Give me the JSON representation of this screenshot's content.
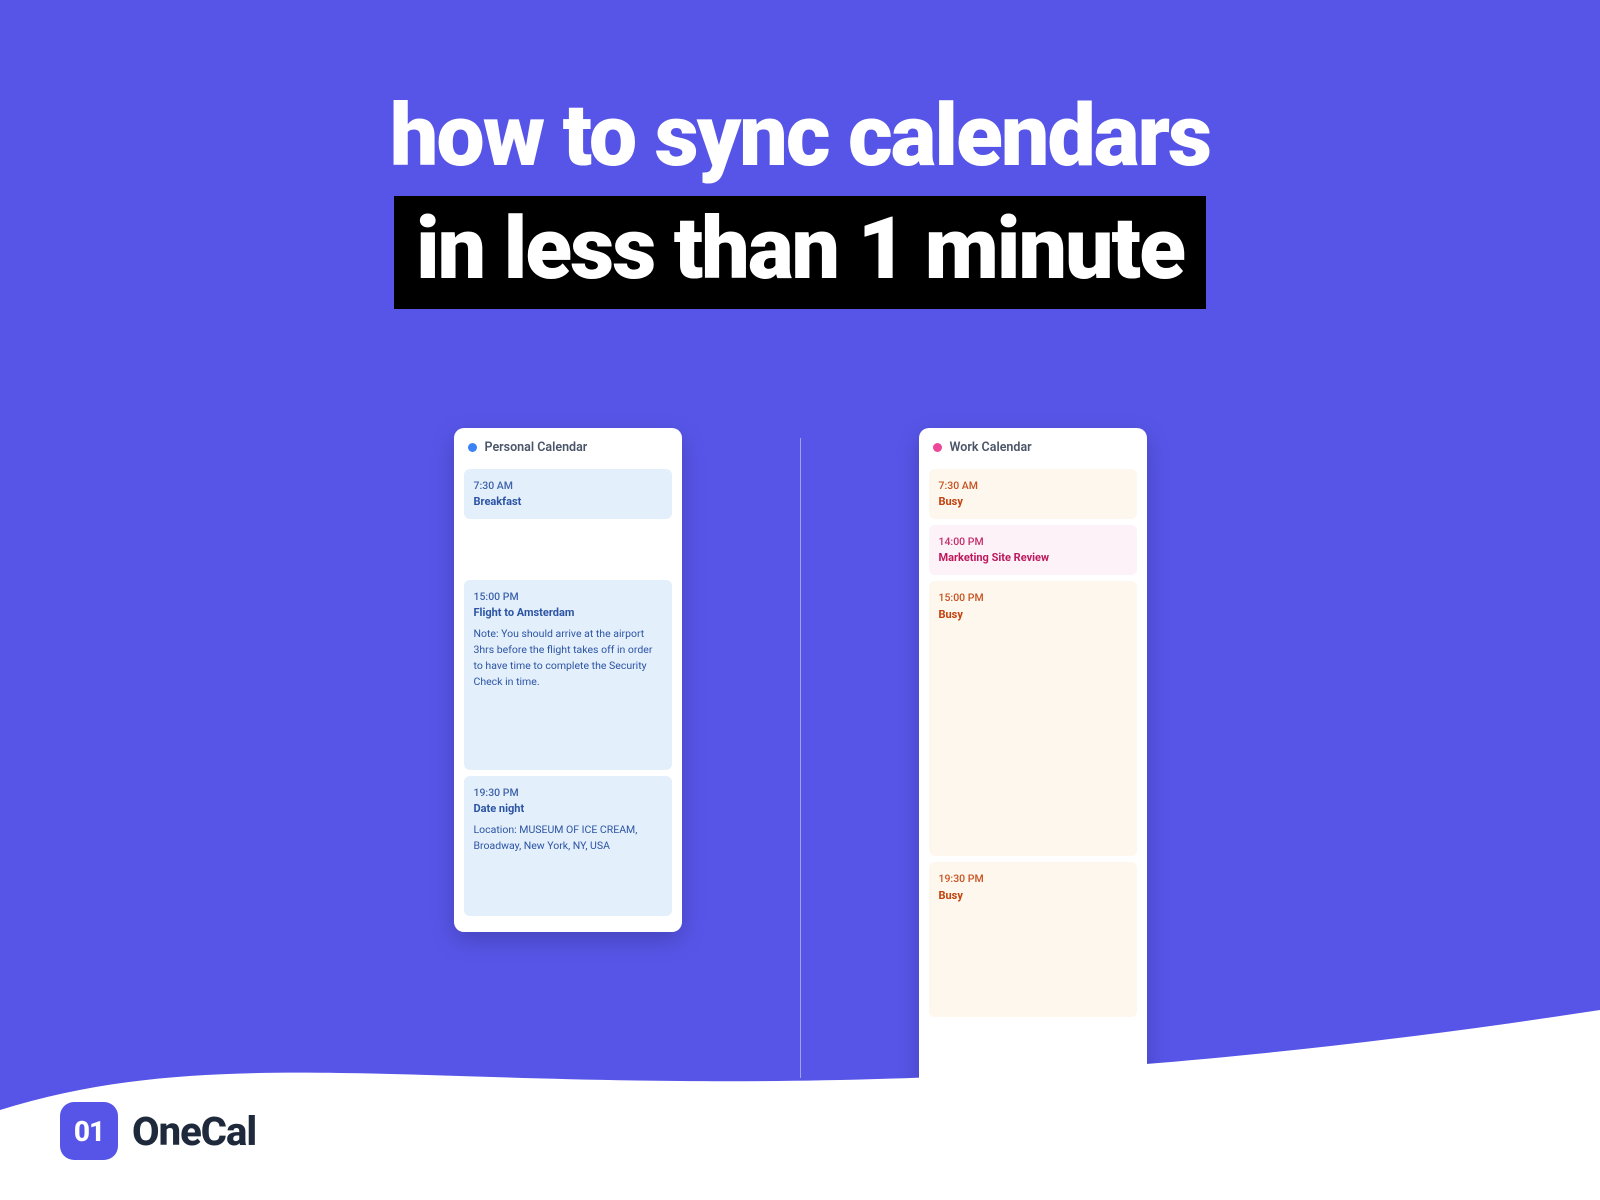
{
  "headline": {
    "line1": "how to sync calendars",
    "line2": "in less than 1 minute"
  },
  "calendars": {
    "personal": {
      "title": "Personal Calendar",
      "events": [
        {
          "time": "7:30 AM",
          "title": "Breakfast"
        },
        {
          "time": "15:00 PM",
          "title": "Flight to Amsterdam",
          "body": "Note: You should arrive at the airport 3hrs before the flight takes off in order to have time to complete the Security Check in time."
        },
        {
          "time": "19:30 PM",
          "title": "Date night",
          "body": "Location: MUSEUM OF ICE CREAM, Broadway, New York, NY, USA"
        }
      ]
    },
    "work": {
      "title": "Work Calendar",
      "events": [
        {
          "time": "7:30 AM",
          "title": "Busy"
        },
        {
          "time": "14:00 PM",
          "title": "Marketing Site Review"
        },
        {
          "time": "15:00 PM",
          "title": "Busy"
        },
        {
          "time": "19:30 PM",
          "title": "Busy"
        }
      ]
    }
  },
  "brand": {
    "badge": "01",
    "name": "OneCal"
  }
}
